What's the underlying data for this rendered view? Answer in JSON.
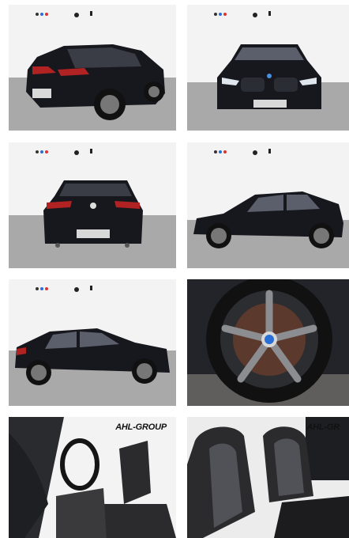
{
  "gallery": {
    "photos": [
      {
        "view": "rear-three-quarter",
        "alt": ""
      },
      {
        "view": "front",
        "alt": ""
      },
      {
        "view": "rear",
        "alt": ""
      },
      {
        "view": "side-right",
        "alt": ""
      },
      {
        "view": "side-left",
        "alt": ""
      },
      {
        "view": "wheel-closeup",
        "alt": ""
      },
      {
        "view": "interior-driver",
        "watermark": "AHL-GROUP"
      },
      {
        "view": "interior-seats",
        "watermark": "AHL-GR"
      }
    ]
  },
  "colors": {
    "car_body": "#16161d",
    "studio_wall": "#f2f2f2",
    "studio_floor": "#a7a7a7",
    "interior_leather": "#2b2b2d",
    "wheel_spoke": "#8b8d91"
  }
}
